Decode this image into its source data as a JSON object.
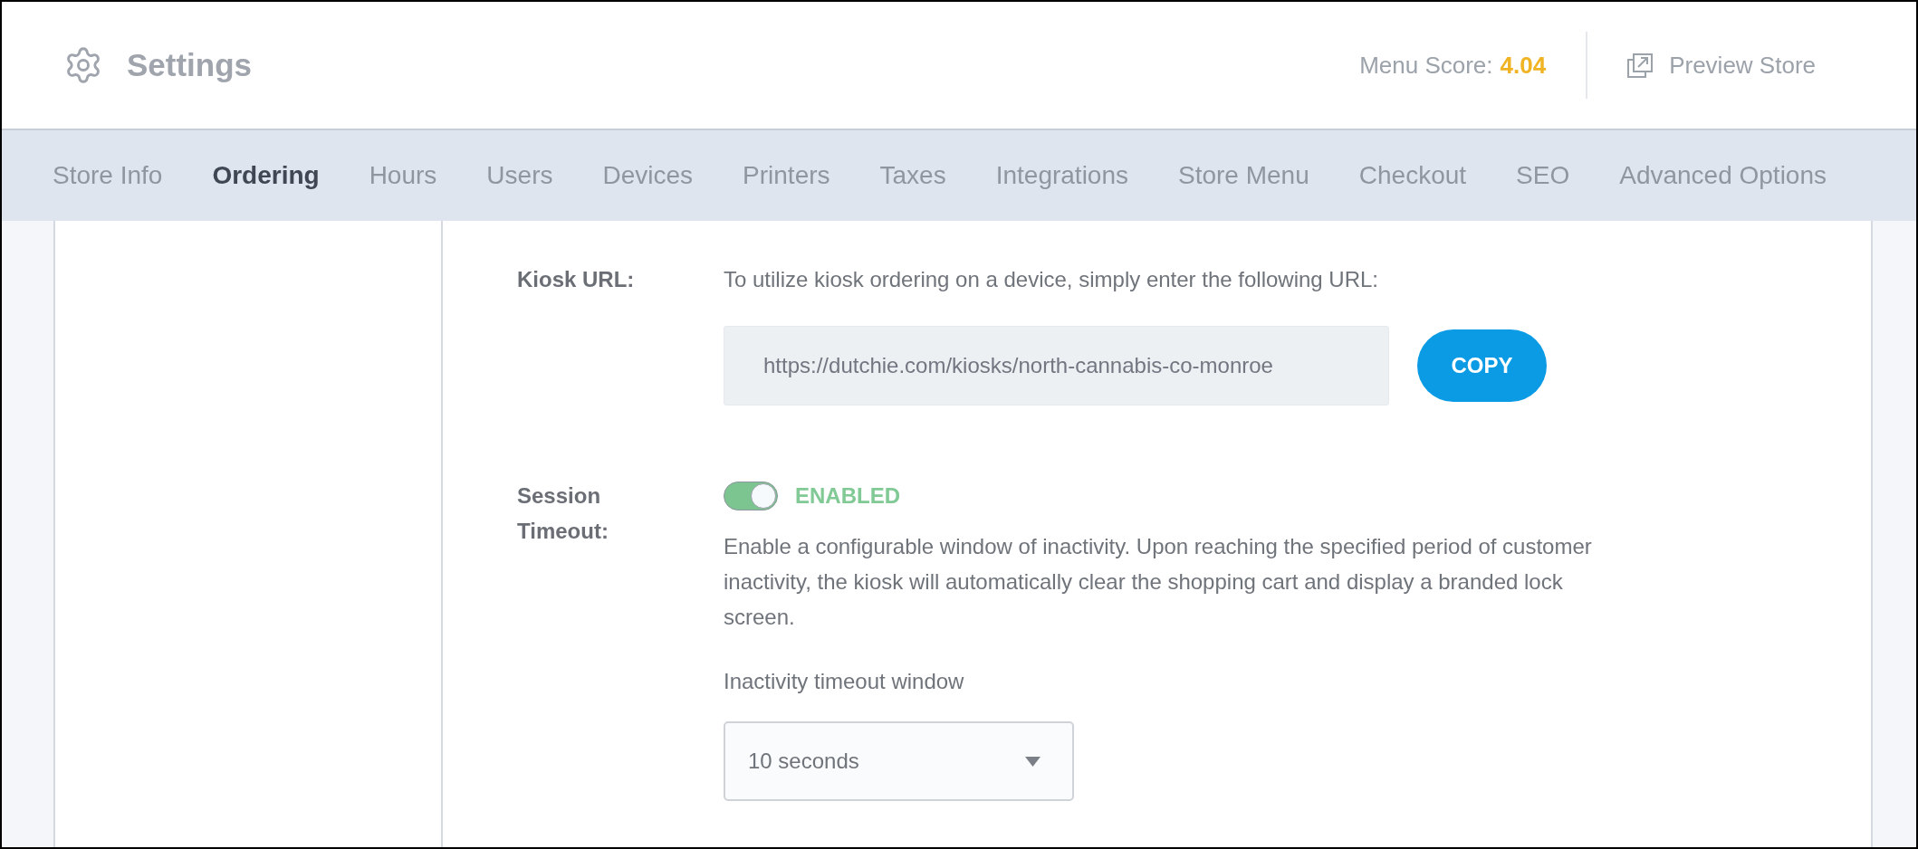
{
  "header": {
    "title": "Settings",
    "menu_score_label": "Menu Score:",
    "menu_score_value": "4.04",
    "preview_button": "Preview Store"
  },
  "tabs": [
    {
      "label": "Store Info",
      "selected": false
    },
    {
      "label": "Ordering",
      "selected": true
    },
    {
      "label": "Hours",
      "selected": false
    },
    {
      "label": "Users",
      "selected": false
    },
    {
      "label": "Devices",
      "selected": false
    },
    {
      "label": "Printers",
      "selected": false
    },
    {
      "label": "Taxes",
      "selected": false
    },
    {
      "label": "Integrations",
      "selected": false
    },
    {
      "label": "Store Menu",
      "selected": false
    },
    {
      "label": "Checkout",
      "selected": false
    },
    {
      "label": "SEO",
      "selected": false
    },
    {
      "label": "Advanced Options",
      "selected": false
    }
  ],
  "kiosk_url": {
    "label": "Kiosk URL:",
    "description": "To utilize kiosk ordering on a device, simply enter the following URL:",
    "url": "https://dutchie.com/kiosks/north-cannabis-co-monroe",
    "copy_button": "COPY"
  },
  "session_timeout": {
    "label": "Session Timeout:",
    "on": true,
    "status": "ENABLED",
    "description": "Enable a configurable window of inactivity. Upon reaching the specified period of customer inactivity, the kiosk will automatically clear the shopping cart and display a branded lock screen.",
    "select_label": "Inactivity timeout window",
    "select_value": "10 seconds"
  }
}
